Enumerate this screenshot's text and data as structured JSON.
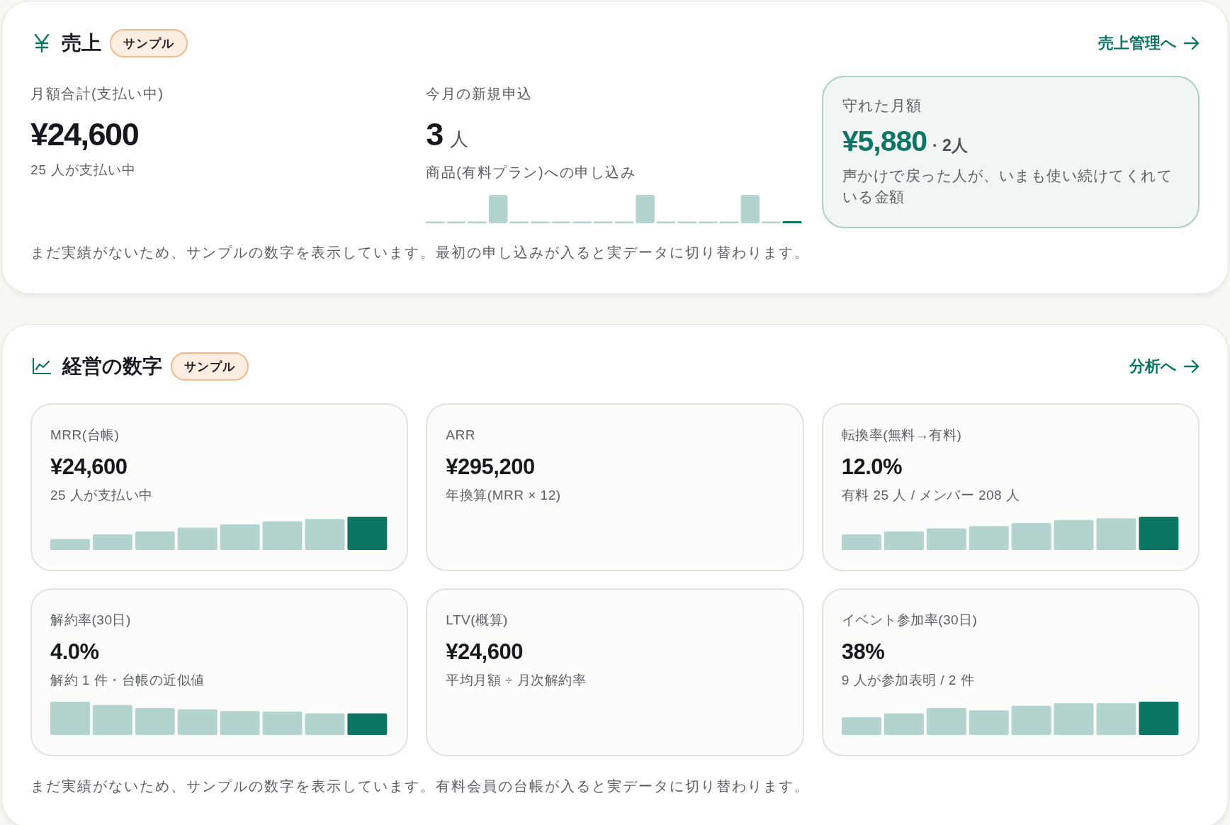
{
  "sales": {
    "title": "売上",
    "badge": "サンプル",
    "link": "売上管理へ",
    "stats": [
      {
        "kind": "plain",
        "label": "月額合計(支払い中)",
        "value": "¥24,600",
        "note": "25 人が支払い中"
      },
      {
        "kind": "chart",
        "label": "今月の新規申込",
        "value": "3",
        "unit": "人",
        "note": "商品(有料プラン)への申し込み"
      }
    ],
    "highlight": {
      "label": "守れた月額",
      "value": "¥5,880",
      "extra": "· 2人",
      "note": "声かけで戻った人が、いまも使い続けてくれている金額"
    },
    "footnote": "まだ実績がないため、サンプルの数字を表示しています。最初の申し込みが入ると実データに切り替わります。"
  },
  "metrics": {
    "title": "経営の数字",
    "badge": "サンプル",
    "link": "分析へ",
    "cards": [
      {
        "kind": "chart",
        "label": "MRR(台帳)",
        "value": "¥24,600",
        "note": "25 人が支払い中"
      },
      {
        "kind": "plain",
        "label": "ARR",
        "value": "¥295,200",
        "note": "年換算(MRR × 12)"
      },
      {
        "kind": "chart",
        "label": "転換率(無料→有料)",
        "value": "12.0%",
        "note": "有料 25 人 / メンバー 208 人"
      },
      {
        "kind": "chart",
        "label": "解約率(30日)",
        "value": "4.0%",
        "note": "解約 1 件・台帳の近似値"
      },
      {
        "kind": "plain",
        "label": "LTV(概算)",
        "value": "¥24,600",
        "note": "平均月額 ÷ 月次解約率"
      },
      {
        "kind": "chart",
        "label": "イベント参加率(30日)",
        "value": "38%",
        "note": "9 人が参加表明 / 2 件"
      }
    ],
    "footnote": "まだ実績がないため、サンプルの数字を表示しています。有料会員の台帳が入ると実データに切り替わります。"
  }
}
